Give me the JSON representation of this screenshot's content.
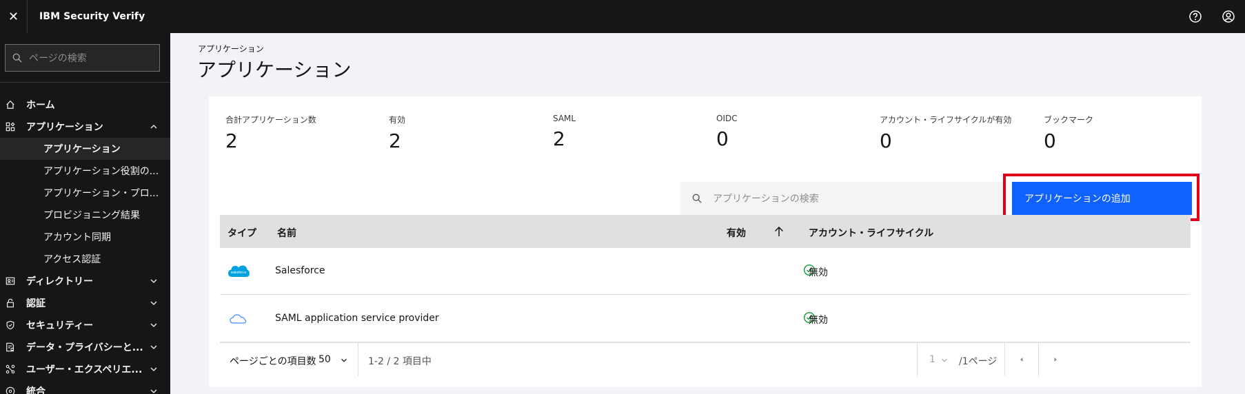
{
  "header": {
    "close_glyph": "✕",
    "brand": "IBM Security Verify",
    "help_icon": "help-icon",
    "user_icon": "user-icon"
  },
  "sidebar": {
    "search_placeholder": "ページの検索",
    "items": [
      {
        "label": "ホーム",
        "icon": "home-icon"
      },
      {
        "label": "アプリケーション",
        "icon": "apps-icon",
        "expanded": true,
        "children": [
          "アプリケーション",
          "アプリケーション役割の...",
          "アプリケーション・プロ...",
          "プロビジョニング結果",
          "アカウント同期",
          "アクセス認証"
        ]
      },
      {
        "label": "ディレクトリー",
        "icon": "directory-icon"
      },
      {
        "label": "認証",
        "icon": "lock-icon"
      },
      {
        "label": "セキュリティー",
        "icon": "shield-icon"
      },
      {
        "label": "データ・プライバシーと...",
        "icon": "data-privacy-icon"
      },
      {
        "label": "ユーザー・エクスペリエ...",
        "icon": "user-experience-icon"
      },
      {
        "label": "統合",
        "icon": "integration-icon"
      }
    ],
    "active_child": "アプリケーション"
  },
  "main": {
    "breadcrumb": "アプリケーション",
    "title": "アプリケーション",
    "stats": [
      {
        "label": "合計アプリケーション数",
        "value": "2"
      },
      {
        "label": "有効",
        "value": "2"
      },
      {
        "label": "SAML",
        "value": "2"
      },
      {
        "label": "OIDC",
        "value": "0"
      },
      {
        "label": "アカウント・ライフサイクルが有効",
        "value": "0"
      },
      {
        "label": "ブックマーク",
        "value": "0"
      }
    ],
    "search_placeholder": "アプリケーションの検索",
    "add_button": "アプリケーションの追加",
    "table": {
      "headers": {
        "type": "タイプ",
        "name": "名前",
        "enabled": "有効",
        "lifecycle": "アカウント・ライフサイクル"
      },
      "rows": [
        {
          "name": "Salesforce",
          "logo": "salesforce-logo",
          "logo_text": "salesforce",
          "enabled": true,
          "lifecycle": "無効"
        },
        {
          "name": "SAML application service provider",
          "logo": "cloud-icon",
          "enabled": true,
          "lifecycle": "無効"
        }
      ]
    },
    "pagination": {
      "items_per_page_label": "ページごとの項目数",
      "items_per_page": "50",
      "range": "1-2 / 2 項目中",
      "page": "1",
      "of_pages": "/1ページ"
    }
  },
  "colors": {
    "accent": "#0f62fe",
    "highlight": "#e0001b",
    "success": "#24a148"
  }
}
